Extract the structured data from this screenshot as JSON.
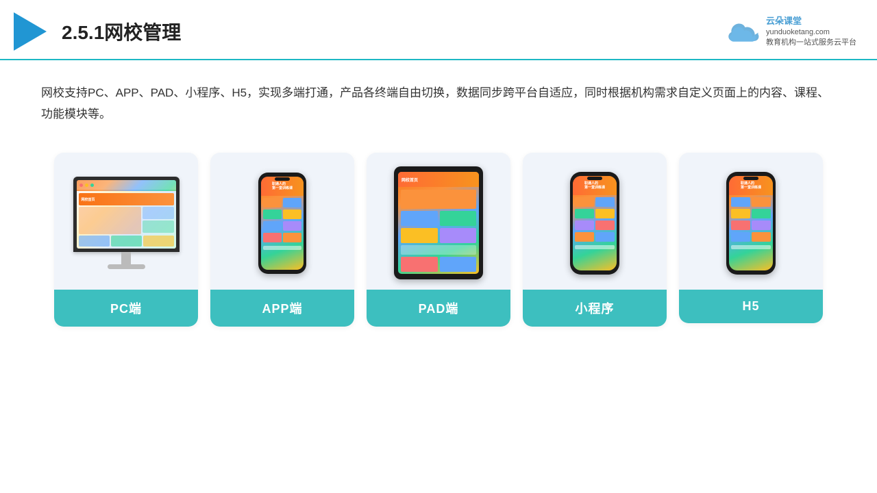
{
  "header": {
    "section_number": "2.5.1",
    "title": "网校管理",
    "brand_name": "云朵课堂",
    "brand_url": "yunduoketang.com",
    "brand_tagline": "教育机构一站",
    "brand_tagline2": "式服务云平台"
  },
  "description": {
    "text": "网校支持PC、APP、PAD、小程序、H5，实现多端打通，产品各终端自由切换，数据同步跨平台自适应，同时根据机构需求自定义页面上的内容、课程、功能模块等。"
  },
  "cards": [
    {
      "id": "pc",
      "label": "PC端"
    },
    {
      "id": "app",
      "label": "APP端"
    },
    {
      "id": "pad",
      "label": "PAD端"
    },
    {
      "id": "miniprogram",
      "label": "小程序"
    },
    {
      "id": "h5",
      "label": "H5"
    }
  ]
}
